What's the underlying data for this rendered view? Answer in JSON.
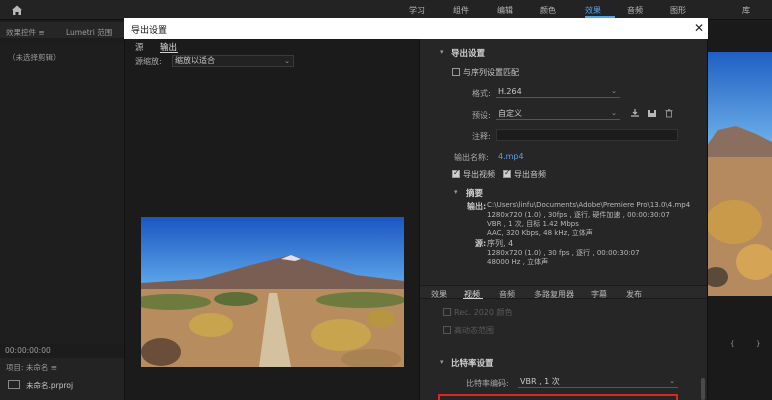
{
  "workspace_tabs": [
    "学习",
    "组件",
    "编辑",
    "颜色",
    "效果",
    "音频",
    "图形",
    "库"
  ],
  "active_workspace": "效果",
  "left_panel": {
    "tab_effect_controls": "效果控件 ≡",
    "tab_lumetri": "Lumetri 范围",
    "no_clip": "（未选择剪辑）",
    "timecode": "00:00:00:00",
    "project_tab": "项目: 未命名 ≡",
    "project_file": "未命名.prproj"
  },
  "dialog": {
    "title": "导出设置",
    "close_glyph": "✕",
    "source_tabs": [
      "源",
      "输出"
    ],
    "scale_label": "源缩放:",
    "scale_value": "缩放以适合",
    "export_settings_header": "导出设置",
    "match_sequence_label": "与序列设置匹配",
    "format_label": "格式:",
    "format_value": "H.264",
    "preset_label": "预设:",
    "preset_value": "自定义",
    "comment_label": "注释:",
    "comment_value": "",
    "output_name_label": "输出名称:",
    "output_name_value": "4.mp4",
    "export_video_label": "导出视频",
    "export_audio_label": "导出音频",
    "summary_header": "摘要",
    "summary_output_label": "输出:",
    "summary_output_lines": [
      "C:\\Users\\linfu\\Documents\\Adobe\\Premiere Pro\\13.0\\4.mp4",
      "1280x720 (1.0) , 30fps , 逐行, 硬件加速 , 00:00:30:07",
      "VBR , 1 次, 目标 1.42 Mbps",
      "AAC, 320 Kbps, 48  kHz, 立体声"
    ],
    "summary_source_label": "源:",
    "summary_source_lines": [
      "序列, 4",
      "1280x720 (1.0) , 30 fps , 逐行 , 00:00:30:07",
      "48000 Hz , 立体声"
    ],
    "bottom_tabs": [
      "效果",
      "视频",
      "音频",
      "多路复用器",
      "字幕",
      "发布"
    ],
    "active_bottom_tab": "视频",
    "rec2020_label": "Rec. 2020 颜色",
    "hdr_label": "高动态范围",
    "bitrate_header": "比特率设置",
    "bitrate_encoding_label": "比特率编码:",
    "bitrate_encoding_value": "VBR , 1 次"
  },
  "colors": {
    "accent": "#5aa0e6",
    "highlight_box": "#e02424",
    "dialog_title_bg": "#ffffff"
  },
  "icons": [
    "home-icon",
    "close-icon",
    "import-preset-icon",
    "save-preset-icon",
    "delete-preset-icon"
  ]
}
